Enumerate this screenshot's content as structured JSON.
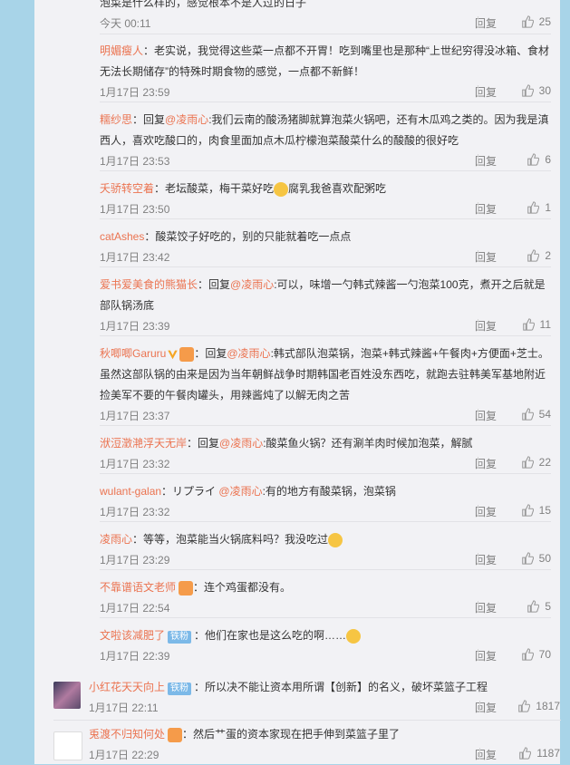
{
  "comments": [
    {
      "user": "",
      "body": "泡菜是什么样的，感觉根本不是人过的日子",
      "time": "今天 00:11",
      "likes": "25"
    },
    {
      "user": "明媚瘦人",
      "body": "：老实说，我觉得这些菜一点都不开胃！吃到嘴里也是那种“上世纪穷得没冰箱、食材无法长期储存”的特殊时期食物的感觉，一点都不新鲜！",
      "time": "1月17日 23:59",
      "likes": "30"
    },
    {
      "user": "糯纱思",
      "prefix": "：回复",
      "at": "@凌雨心",
      "body": ":我们云南的酸汤猪脚就算泡菜火锅吧，还有木瓜鸡之类的。因为我是滇西人，喜欢吃酸口的，肉食里面加点木瓜柠檬泡菜酸菜什么的酸酸的很好吃",
      "time": "1月17日 23:53",
      "likes": "6"
    },
    {
      "user": "夭骄转空着",
      "body": "：老坛酸菜，梅干菜好吃",
      "body2": "腐乳我爸喜欢配粥吃",
      "time": "1月17日 23:50",
      "likes": "1"
    },
    {
      "user": "catAshes",
      "body": "：酸菜饺子好吃的，别的只能就着吃一点点",
      "time": "1月17日 23:42",
      "likes": "2"
    },
    {
      "user": "爱书爱美食的熊猫长",
      "prefix": "：回复",
      "at": "@凌雨心",
      "body": ":可以，味增一勺韩式辣酱一勺泡菜100克，煮开之后就是部队锅汤底",
      "time": "1月17日 23:39",
      "likes": "11"
    },
    {
      "user": "秋唧唧Garuru",
      "prefix": "：回复",
      "at": "@凌雨心",
      "body": ":韩式部队泡菜锅，泡菜+韩式辣酱+午餐肉+方便面+芝士。虽然这部队锅的由来是因为当年朝鲜战争时期韩国老百姓没东西吃，就跑去驻韩美军基地附近捡美军不要的午餐肉罐头，用辣酱炖了以解无肉之苦",
      "time": "1月17日 23:37",
      "likes": "54"
    },
    {
      "user": "洑浢澂滟浮天无岸",
      "prefix": "：回复",
      "at": "@凌雨心",
      "body": ":酸菜鱼火锅？还有涮羊肉时候加泡菜，解腻",
      "time": "1月17日 23:32",
      "likes": "22"
    },
    {
      "user": "wulant-galan",
      "prefix": "：リプライ ",
      "at": "@凌雨心",
      "body": ":有的地方有酸菜锅，泡菜锅",
      "time": "1月17日 23:32",
      "likes": "15"
    },
    {
      "user": "凌雨心",
      "body": "：等等，泡菜能当火锅底料吗？我没吃过",
      "time": "1月17日 23:29",
      "likes": "50"
    },
    {
      "user": "不靠谱语文老师",
      "body": "：连个鸡蛋都没有。",
      "time": "1月17日 22:54",
      "likes": "5"
    },
    {
      "user": "文啦该减肥了",
      "badge": "铁粉",
      "body": "：他们在家也是这么吃的啊……",
      "time": "1月17日 22:39",
      "likes": "70"
    }
  ],
  "top_comments": [
    {
      "user": "小红花天天向上",
      "badge": "铁粉",
      "body": "：所以决不能让资本用所谓【创新】的名义，破坏菜篮子工程",
      "time": "1月17日 22:11",
      "likes": "1817"
    },
    {
      "user": "兎渡不归知何处",
      "body": "：然后艹蛋的资本家现在把手伸到菜篮子里了",
      "time": "1月17日 22:29",
      "likes": "1187"
    }
  ],
  "labels": {
    "reply": "回复"
  }
}
